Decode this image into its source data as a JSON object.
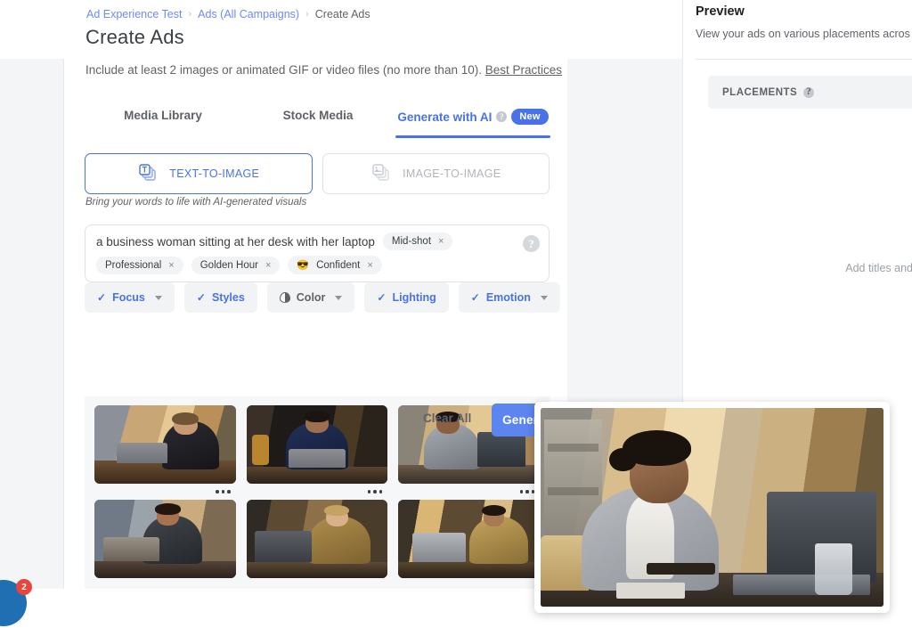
{
  "breadcrumb": {
    "items": [
      {
        "label": "Ad Experience Test",
        "type": "link"
      },
      {
        "label": "Ads (All Campaigns)",
        "type": "link"
      },
      {
        "label": "Create Ads",
        "type": "current"
      }
    ],
    "separator": "›"
  },
  "page_title": "Create Ads",
  "helper": {
    "text": "Include at least 2 images or animated GIF or video files (no more than 10).",
    "link_label": "Best Practices"
  },
  "tabs": [
    {
      "label": "Media Library",
      "active": false
    },
    {
      "label": "Stock Media",
      "active": false
    },
    {
      "label": "Generate with AI",
      "active": true,
      "help_icon": "help-circle-icon",
      "badge": "New"
    }
  ],
  "modes": [
    {
      "label": "TEXT-TO-IMAGE",
      "icon": "text-to-image-icon",
      "selected": true
    },
    {
      "label": "IMAGE-TO-IMAGE",
      "icon": "image-to-image-icon",
      "selected": false
    }
  ],
  "mode_caption": "Bring your words to life with AI-generated visuals",
  "prompt": {
    "value": "a business woman sitting at her desk with her laptop",
    "help_icon": "help-circle-icon",
    "remove_glyph": "×",
    "chips": [
      {
        "label": "Mid-shot",
        "emoji": ""
      },
      {
        "label": "Professional",
        "emoji": ""
      },
      {
        "label": "Golden Hour",
        "emoji": ""
      },
      {
        "label": "Confident",
        "emoji": "😎"
      }
    ]
  },
  "filters": [
    {
      "label": "Focus",
      "checked": true,
      "caret": true,
      "icon": "check-icon"
    },
    {
      "label": "Styles",
      "checked": true,
      "caret": false,
      "icon": "check-icon"
    },
    {
      "label": "Color",
      "checked": false,
      "caret": true,
      "icon": "color-droplet-icon"
    },
    {
      "label": "Lighting",
      "checked": true,
      "caret": false,
      "icon": "check-icon"
    },
    {
      "label": "Emotion",
      "checked": true,
      "caret": true,
      "icon": "check-icon"
    }
  ],
  "actions": {
    "clear_all": "Clear All",
    "generate": "Generate Images"
  },
  "results": {
    "menu_glyph": "•••",
    "images": [
      {
        "alt": "business woman in black blazer at laptop by window",
        "menu": true
      },
      {
        "alt": "business woman in navy blazer facing camera at laptop",
        "menu": true
      },
      {
        "alt": "business woman in grey blazer typing on laptop",
        "menu": true
      },
      {
        "alt": "business woman in dark suit leaning over laptop",
        "menu": false
      },
      {
        "alt": "blonde woman in gold jacket with glasses at laptop",
        "menu": false
      },
      {
        "alt": "woman in gold sequin jacket with glasses at laptop",
        "menu": false
      }
    ]
  },
  "hover_preview": {
    "alt": "enlarged preview: business woman in grey blazer typing on laptop"
  },
  "preview_panel": {
    "title": "Preview",
    "subtitle": "View your ads on various placements acros",
    "placements_label": "PLACEMENTS",
    "placements_help_icon": "help-circle-icon",
    "placeholder": "Add titles and"
  },
  "chat_widget": {
    "unread_count": "2",
    "icon": "chat-bubble-icon"
  },
  "colors": {
    "accent_blue": "#4a72e8",
    "button_blue": "#5c85ef",
    "badge_red": "#e8453c",
    "chat_blue": "#1f6fb2",
    "text_primary": "#3c4043",
    "text_secondary": "#5f6368",
    "panel_bg": "#f4f5f7"
  }
}
